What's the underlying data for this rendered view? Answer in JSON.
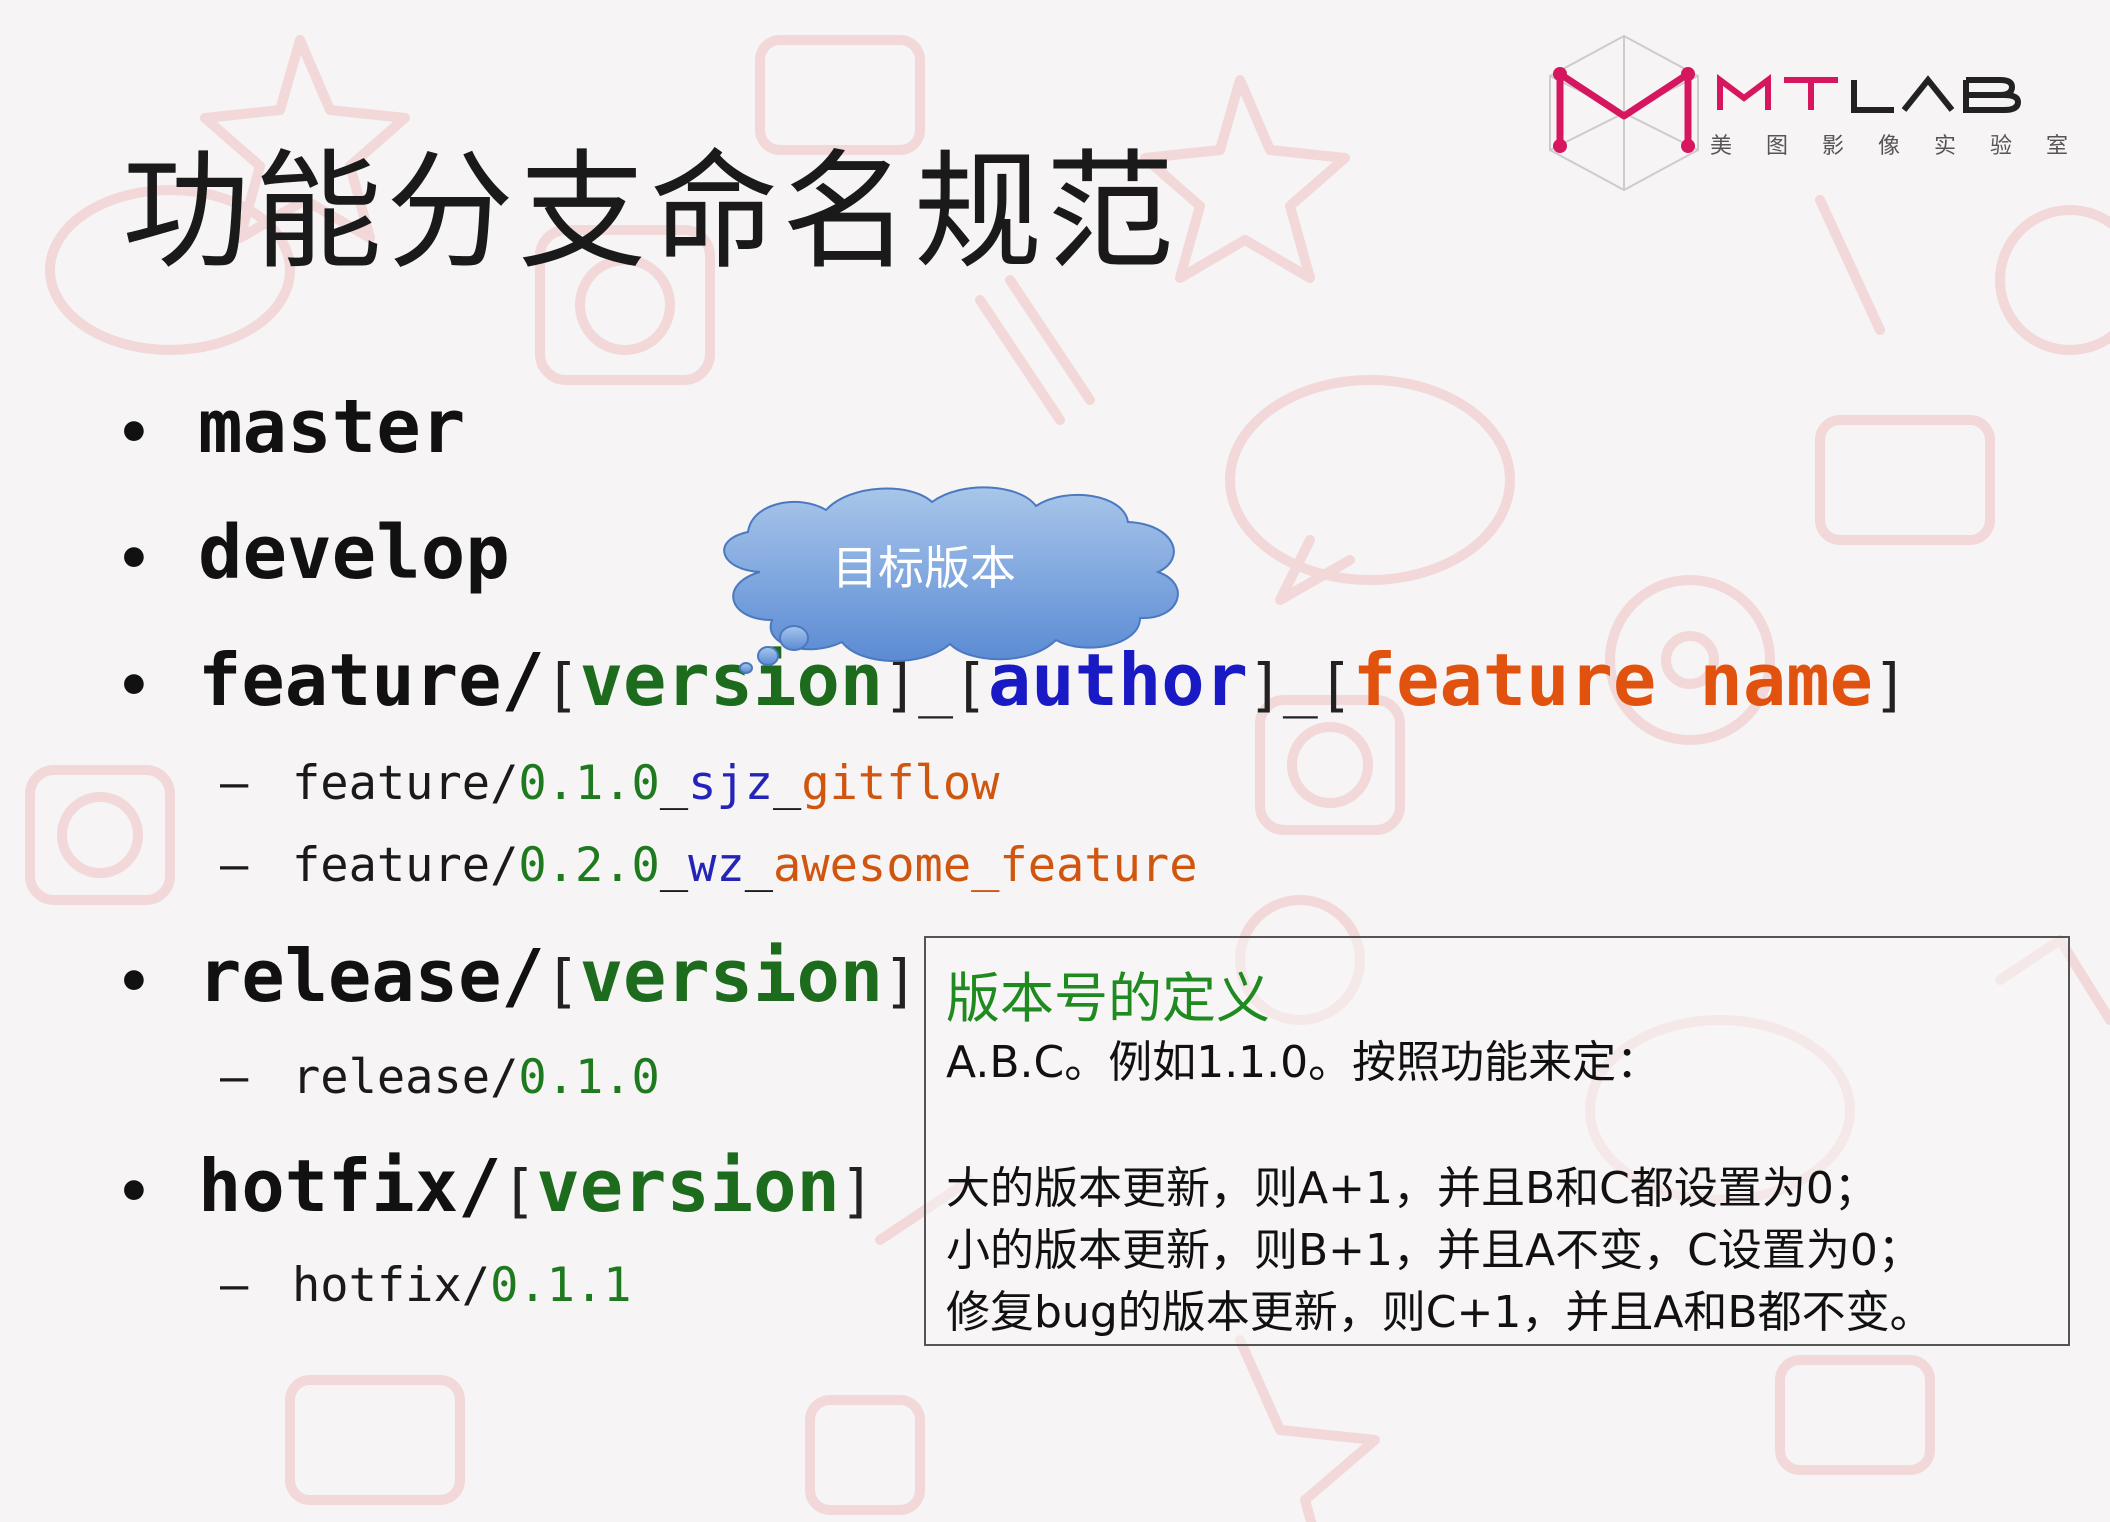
{
  "slide": {
    "title": "功能分支命名规范"
  },
  "logo": {
    "brand": "MTLAB",
    "subtitle": "美图影像实验室",
    "color": "#d6165e"
  },
  "bullets": {
    "master": "master",
    "develop": "develop",
    "feature": {
      "prefix": "feature/",
      "open1": "[",
      "version": "version",
      "close1": "]",
      "sep1": "_",
      "open2": "[",
      "author": "author",
      "close2": "]",
      "sep2": "_",
      "open3": "[",
      "name": "feature name",
      "close3": "]"
    },
    "feature_examples": [
      {
        "prefix": "feature/",
        "version": "0.1.0",
        "sep1": "_",
        "author": "sjz",
        "sep2": "_",
        "name": "gitflow"
      },
      {
        "prefix": "feature/",
        "version": "0.2.0",
        "sep1": "_",
        "author": "wz",
        "sep2": "_",
        "name": "awesome_feature"
      }
    ],
    "release": {
      "prefix": "release/",
      "open": "[",
      "version": "version",
      "close": "]"
    },
    "release_example": {
      "prefix": "release/",
      "version": "0.1.0"
    },
    "hotfix": {
      "prefix": "hotfix/",
      "open": "[",
      "version": "version",
      "close": "]"
    },
    "hotfix_example": {
      "prefix": "hotfix/",
      "version": "0.1.1"
    }
  },
  "callout": {
    "text": "目标版本"
  },
  "definition": {
    "title": "版本号的定义",
    "line1": "A.B.C。例如1.1.0。按照功能来定：",
    "line2": "大的版本更新，则A+1，并且B和C都设置为0；",
    "line3": "小的版本更新，则B+1，并且A不变，C设置为0；",
    "line4": "修复bug的版本更新，则C+1，并且A和B都不变。"
  },
  "symbols": {
    "bullet": "•",
    "dash": "–"
  },
  "colors": {
    "version": "#1d6b1d",
    "author": "#1a1ac4",
    "feature_name": "#e0520e",
    "definition_title": "#1f8a1f"
  }
}
